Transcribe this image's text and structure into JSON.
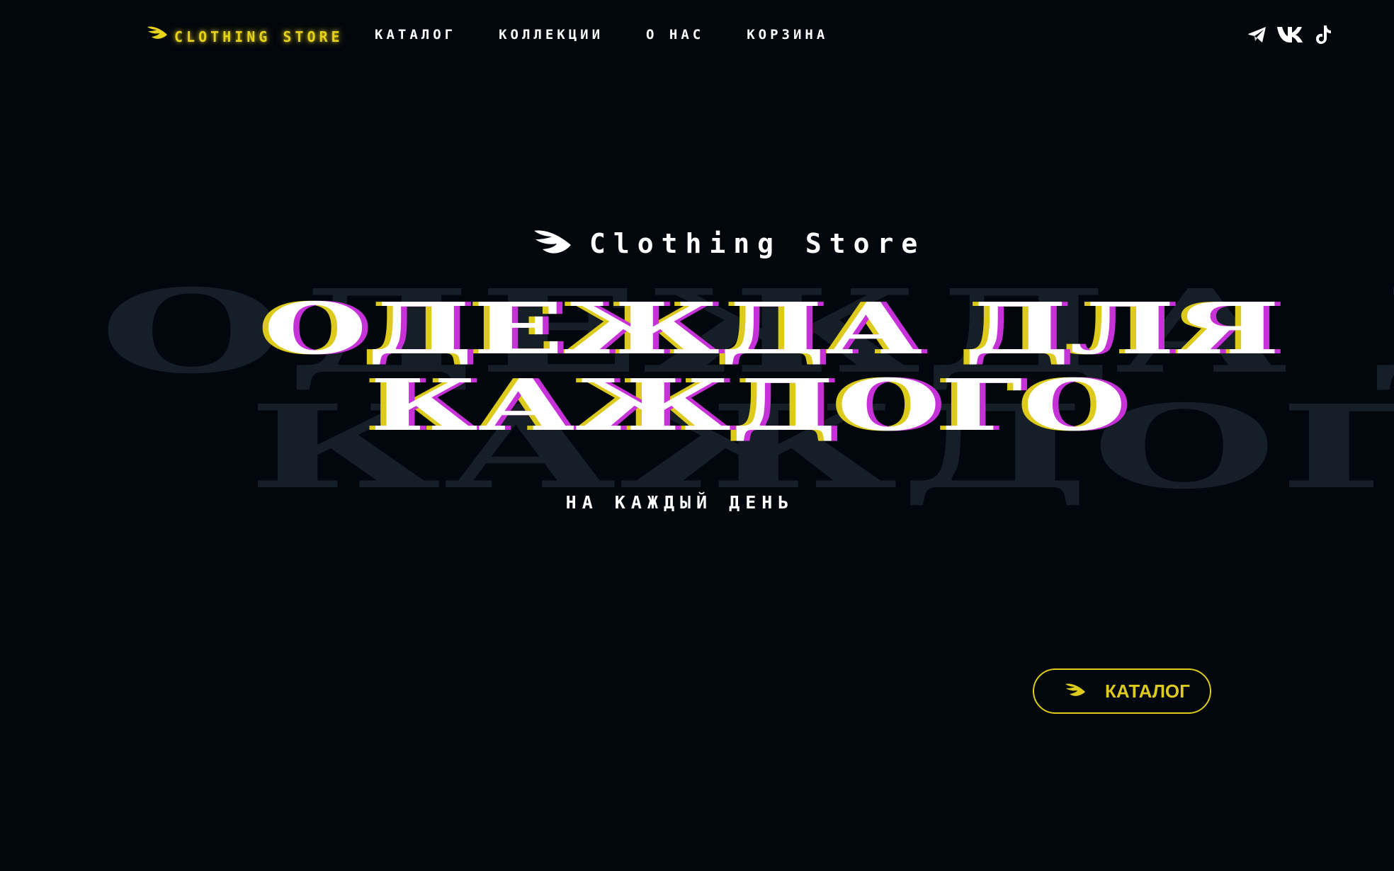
{
  "header": {
    "brand_label": "CLOTHING STORE",
    "nav": [
      {
        "label": "КАТАЛОГ"
      },
      {
        "label": "КОЛЛЕКЦИИ"
      },
      {
        "label": "О НАС"
      },
      {
        "label": "КОРЗИНА"
      }
    ],
    "socials": [
      {
        "icon": "telegram-icon"
      },
      {
        "icon": "vk-icon"
      },
      {
        "icon": "tiktok-icon"
      }
    ]
  },
  "hero": {
    "brand_text": "Clothing Store",
    "title_line1": "ОДЕЖДА ДЛЯ",
    "title_line2": "КАЖДОГО",
    "subtitle": "НА КАЖДЫЙ ДЕНЬ",
    "cta_label": "КАТАЛОГ"
  },
  "colors": {
    "background": "#02060d",
    "accent_yellow": "#dccb1c",
    "accent_magenta": "#c632d8",
    "text": "#ffffff",
    "bg_text": "#161e27"
  }
}
